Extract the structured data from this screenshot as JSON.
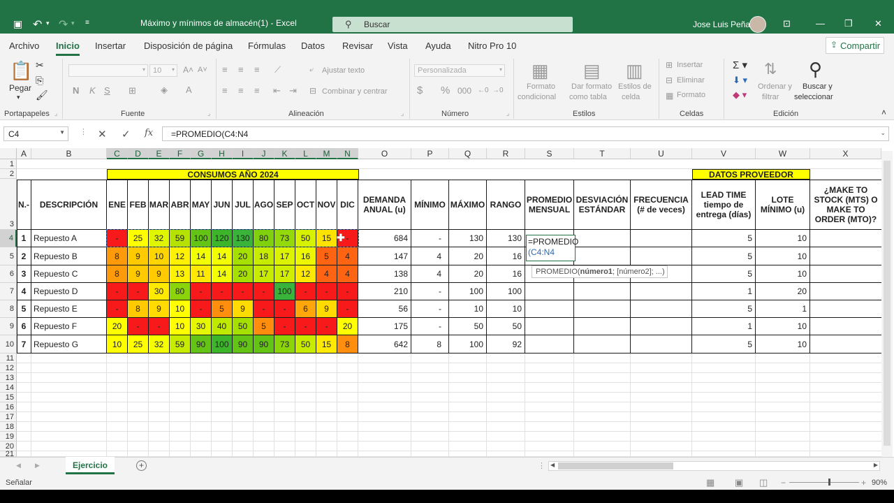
{
  "titlebar": {
    "title": "Máximo y mínimos de almacén(1)  -  Excel",
    "search_placeholder": "Buscar",
    "user": "Jose Luis Peña"
  },
  "menu": [
    "Archivo",
    "Inicio",
    "Insertar",
    "Disposición de página",
    "Fórmulas",
    "Datos",
    "Revisar",
    "Vista",
    "Ayuda",
    "Nitro Pro 10"
  ],
  "share": "Compartir",
  "ribbon": {
    "paste": "Pegar",
    "font_size": "10",
    "wrap_text": "Ajustar texto",
    "merge": "Combinar y centrar",
    "number_format": "Personalizada",
    "cond_format": [
      "Formato",
      "condicional"
    ],
    "format_table": [
      "Dar formato",
      "como tabla"
    ],
    "cell_styles": [
      "Estilos de",
      "celda"
    ],
    "insert": "Insertar",
    "delete": "Eliminar",
    "format": "Formato",
    "sort": [
      "Ordenar y",
      "filtrar"
    ],
    "find": [
      "Buscar y",
      "seleccionar"
    ],
    "groups": [
      "Portapapeles",
      "Fuente",
      "Alineación",
      "Número",
      "Estilos",
      "Celdas",
      "Edición"
    ]
  },
  "formula": {
    "name_box": "C4",
    "content": "=PROMEDIO(C4:N4"
  },
  "columns": [
    "A",
    "B",
    "C",
    "D",
    "E",
    "F",
    "G",
    "H",
    "I",
    "J",
    "K",
    "L",
    "M",
    "N",
    "O",
    "P",
    "Q",
    "R",
    "S",
    "T",
    "U",
    "V",
    "W",
    "X"
  ],
  "rows": [
    "1",
    "2",
    "3",
    "4",
    "5",
    "6",
    "7",
    "8",
    "9",
    "10",
    "11",
    "12",
    "13",
    "14",
    "15",
    "16",
    "17",
    "18",
    "19",
    "20",
    "21"
  ],
  "sheet": {
    "banner_consumos": "CONSUMOS AÑO 2024",
    "banner_proveedor": "DATOS PROVEEDOR",
    "headers": {
      "n": "N.-",
      "desc": "DESCRIPCIÓN",
      "months": [
        "ENE",
        "FEB",
        "MAR",
        "ABR",
        "MAY",
        "JUN",
        "JUL",
        "AGO",
        "SEP",
        "OCT",
        "NOV",
        "DIC"
      ],
      "demanda": "DEMANDA ANUAL (u)",
      "minimo": "MÍNIMO",
      "maximo": "MÁXIMO",
      "rango": "RANGO",
      "promedio": "PROMEDIO MENSUAL",
      "desviacion": "DESVIACIÓN ESTÁNDAR",
      "frecuencia": "FRECUENCIA (# de veces)",
      "leadtime": "LEAD TIME tiempo de entrega (días)",
      "lote": "LOTE MÍNIMO (u)",
      "mts": "¿MAKE TO STOCK (MTS) O MAKE TO ORDER (MTO)?"
    },
    "items": [
      {
        "n": "1",
        "desc": "Repuesto A",
        "months": [
          "-",
          "25",
          "32",
          "59",
          "100",
          "120",
          "130",
          "80",
          "73",
          "50",
          "15",
          "-"
        ],
        "demanda": "684",
        "min": "-",
        "max": "130",
        "rango": "130",
        "lead": "5",
        "lote": "10"
      },
      {
        "n": "2",
        "desc": "Repuesto B",
        "months": [
          "8",
          "9",
          "10",
          "12",
          "14",
          "14",
          "20",
          "18",
          "17",
          "16",
          "5",
          "4"
        ],
        "demanda": "147",
        "min": "4",
        "max": "20",
        "rango": "16",
        "lead": "5",
        "lote": "10"
      },
      {
        "n": "3",
        "desc": "Repuesto C",
        "months": [
          "8",
          "9",
          "9",
          "13",
          "11",
          "14",
          "20",
          "17",
          "17",
          "12",
          "4",
          "4"
        ],
        "demanda": "138",
        "min": "4",
        "max": "20",
        "rango": "16",
        "lead": "5",
        "lote": "10"
      },
      {
        "n": "4",
        "desc": "Repuesto D",
        "months": [
          "-",
          "-",
          "30",
          "80",
          "-",
          "-",
          "-",
          "-",
          "100",
          "-",
          "-",
          "-"
        ],
        "demanda": "210",
        "min": "-",
        "max": "100",
        "rango": "100",
        "lead": "1",
        "lote": "20"
      },
      {
        "n": "5",
        "desc": "Repuesto E",
        "months": [
          "-",
          "8",
          "9",
          "10",
          "-",
          "5",
          "9",
          "-",
          "-",
          "6",
          "9",
          "-"
        ],
        "demanda": "56",
        "min": "-",
        "max": "10",
        "rango": "10",
        "lead": "5",
        "lote": "1"
      },
      {
        "n": "6",
        "desc": "Repuesto F",
        "months": [
          "20",
          "-",
          "-",
          "10",
          "30",
          "40",
          "50",
          "5",
          "-",
          "-",
          "-",
          "20"
        ],
        "demanda": "175",
        "min": "-",
        "max": "50",
        "rango": "50",
        "lead": "1",
        "lote": "10"
      },
      {
        "n": "7",
        "desc": "Repuesto G",
        "months": [
          "10",
          "25",
          "32",
          "59",
          "90",
          "100",
          "90",
          "90",
          "73",
          "50",
          "15",
          "8"
        ],
        "demanda": "642",
        "min": "8",
        "max": "100",
        "rango": "92",
        "lead": "5",
        "lote": "10"
      }
    ],
    "month_colors": [
      [
        "#f8191b",
        "#ffff00",
        "#dff600",
        "#b5e200",
        "#63c416",
        "#3db52a",
        "#39b339",
        "#7ed10c",
        "#93d90b",
        "#d6f200",
        "#ffe300",
        "#f8191b"
      ],
      [
        "#ff9a0b",
        "#ffcb00",
        "#ffd500",
        "#fff200",
        "#f2ff00",
        "#f2ff00",
        "#a5e000",
        "#c7ec00",
        "#dbf200",
        "#ecf700",
        "#ff6412",
        "#ff6412"
      ],
      [
        "#ff9a0b",
        "#ffcb00",
        "#ffcb00",
        "#fff200",
        "#ffe900",
        "#f2ff00",
        "#a5e000",
        "#c7ec00",
        "#d0ef00",
        "#ffe900",
        "#ff6412",
        "#ff6412"
      ],
      [
        "#f8191b",
        "#f8191b",
        "#ffea00",
        "#8bd40a",
        "#f8191b",
        "#f8191b",
        "#f8191b",
        "#f8191b",
        "#39b339",
        "#f8191b",
        "#f8191b",
        "#f8191b"
      ],
      [
        "#f8191b",
        "#ffca00",
        "#ffdb00",
        "#ffff00",
        "#f8191b",
        "#ff8e0e",
        "#ffdb00",
        "#f8191b",
        "#f8191b",
        "#ffa60a",
        "#ffdb00",
        "#f8191b"
      ],
      [
        "#ffff00",
        "#f8191b",
        "#f8191b",
        "#ffff00",
        "#e5f800",
        "#bfea00",
        "#a5e000",
        "#ff8e0e",
        "#f8191b",
        "#f8191b",
        "#f8191b",
        "#ffff00"
      ],
      [
        "#ffff00",
        "#ffff00",
        "#f5ff00",
        "#c7ec00",
        "#63c416",
        "#3db52a",
        "#63c416",
        "#63c416",
        "#8ad40a",
        "#c7ec00",
        "#ffea00",
        "#ff8e0e"
      ]
    ],
    "editing": {
      "line1": "=PROMEDIO",
      "line2": "(C4:N4"
    },
    "tooltip": {
      "fn": "PROMEDIO(",
      "arg1": "número1",
      "rest": "; [número2]; ...)"
    }
  },
  "sheet_tab": "Ejercicio",
  "status": "Señalar",
  "zoom": "90%"
}
